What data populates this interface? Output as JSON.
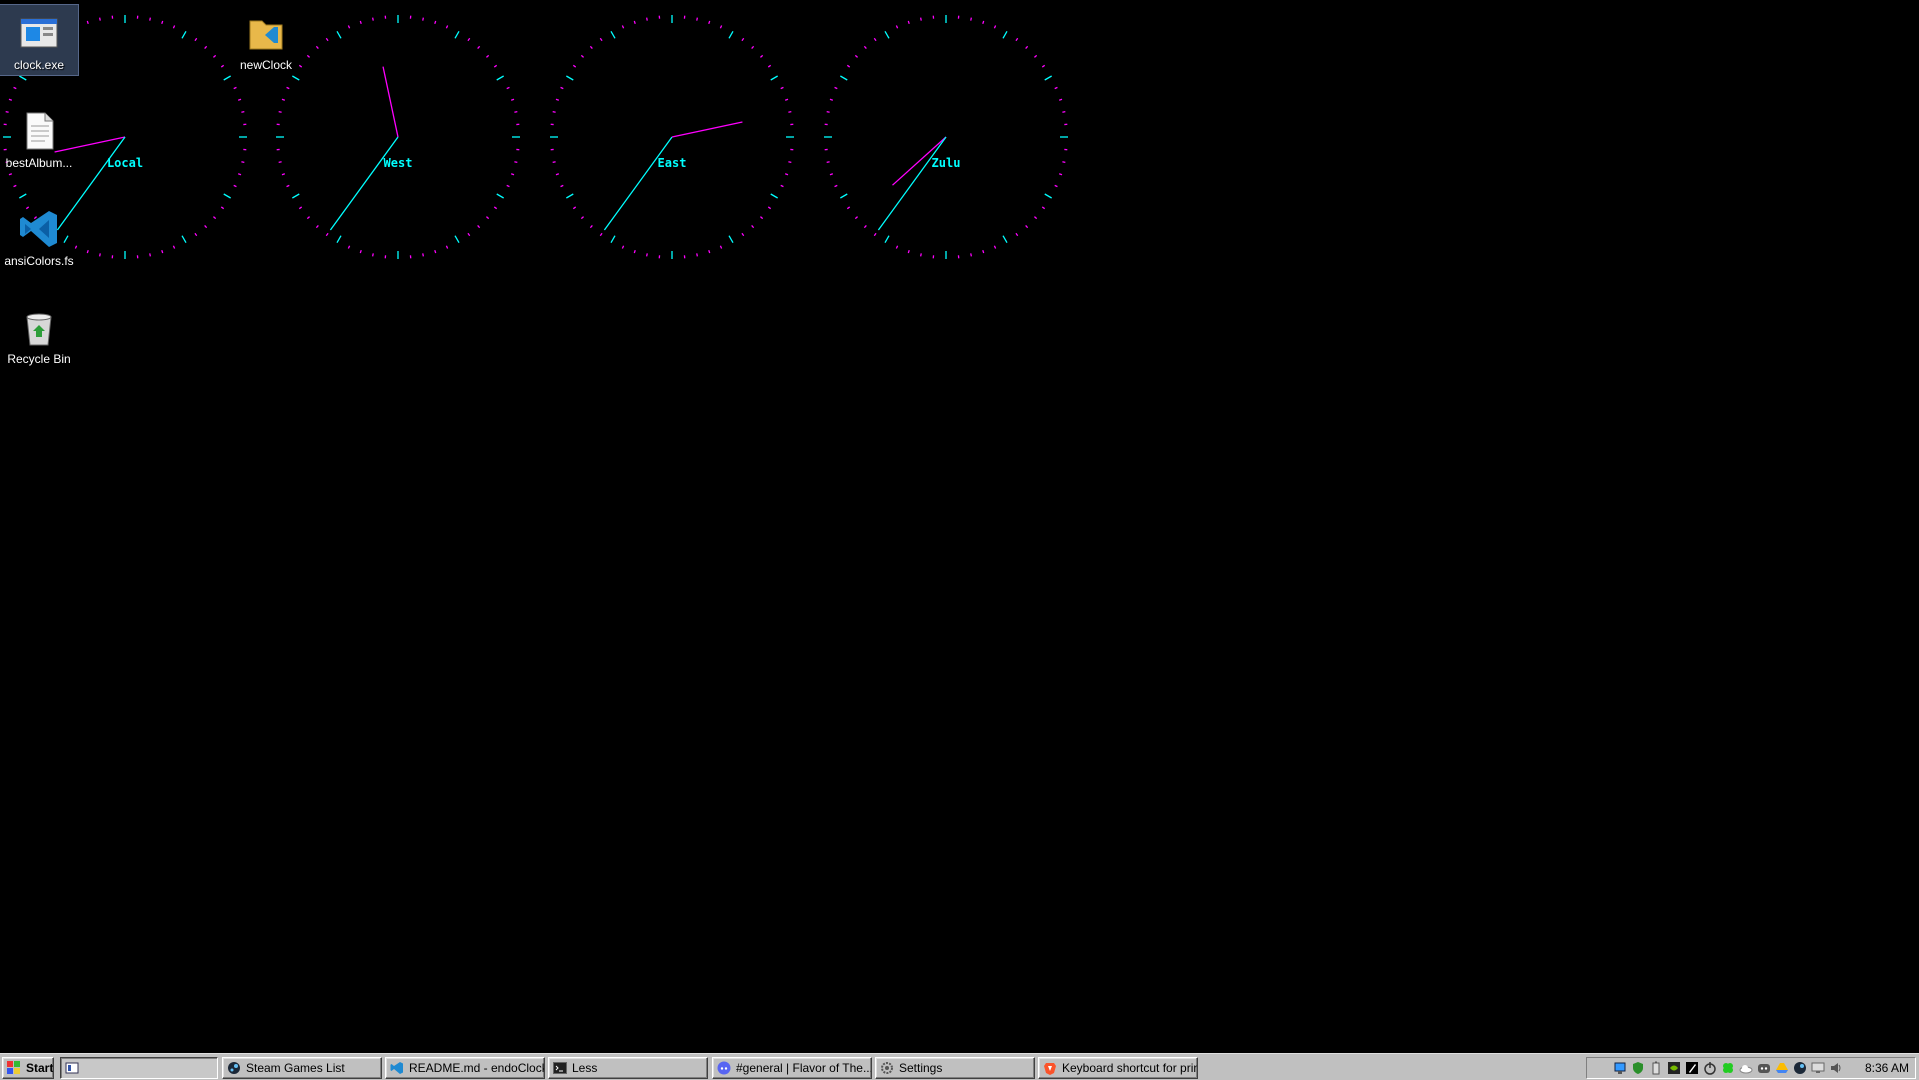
{
  "desktop": {
    "icons": [
      {
        "label": "clock.exe",
        "icon": "clock-exe-icon",
        "selected": true
      },
      {
        "label": "newClock",
        "icon": "folder-vscode-icon",
        "selected": false
      },
      {
        "label": "bestAlbum...",
        "icon": "text-document-icon",
        "selected": false
      },
      {
        "label": "ansiColors.fs",
        "icon": "vscode-icon",
        "selected": false
      },
      {
        "label": "Recycle Bin",
        "icon": "recycle-bin-icon",
        "selected": false
      }
    ]
  },
  "clocks": {
    "items": [
      {
        "label": "Local",
        "hour": 8,
        "minute": 36
      },
      {
        "label": "West",
        "hour": 11,
        "minute": 36
      },
      {
        "label": "East",
        "hour": 2,
        "minute": 36
      },
      {
        "label": "Zulu",
        "hour": 7,
        "minute": 36
      }
    ],
    "colors": {
      "ticks": "#ff00ff",
      "hour_marks": "#00ffff",
      "hand_hour": "#ff00ff",
      "hand_minute": "#00ffff",
      "label": "#00ffff"
    }
  },
  "taskbar": {
    "start_label": "Start",
    "buttons": [
      {
        "label": "",
        "icon": "window-icon",
        "pressed": true
      },
      {
        "label": "Steam Games List",
        "icon": "steam-icon",
        "pressed": false
      },
      {
        "label": "README.md - endoClock...",
        "icon": "vscode-icon",
        "pressed": false
      },
      {
        "label": "Less",
        "icon": "terminal-icon",
        "pressed": false
      },
      {
        "label": "#general | Flavor of The...",
        "icon": "discord-icon",
        "pressed": false
      },
      {
        "label": "Settings",
        "icon": "gear-icon",
        "pressed": false
      },
      {
        "label": "Keyboard shortcut for print...",
        "icon": "brave-icon",
        "pressed": false
      }
    ],
    "tray_icons": [
      "network-icon",
      "shield-icon",
      "battery-icon",
      "nvidia-icon",
      "pen-icon",
      "power-icon",
      "clover-icon",
      "cloud-icon",
      "discord-icon",
      "drive-icon",
      "steam-icon",
      "monitor-icon",
      "volume-icon"
    ],
    "time": "8:36 AM"
  }
}
